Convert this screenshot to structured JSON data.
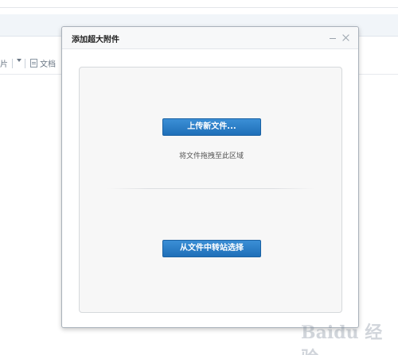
{
  "background": {
    "toolbar": {
      "image_label_fragment": "图片",
      "doc_label": "文档"
    }
  },
  "dialog": {
    "title": "添加超大附件",
    "upload_button_label": "上传新文件...",
    "drop_hint": "将文件拖拽至此区域",
    "transfer_button_label": "从文件中转站选择"
  },
  "watermark": {
    "text": "Baidu 经验"
  },
  "colors": {
    "button_primary": "#2a7cc7",
    "dialog_border": "#a9b1ba",
    "drop_zone_bg": "#f7f7f7"
  }
}
